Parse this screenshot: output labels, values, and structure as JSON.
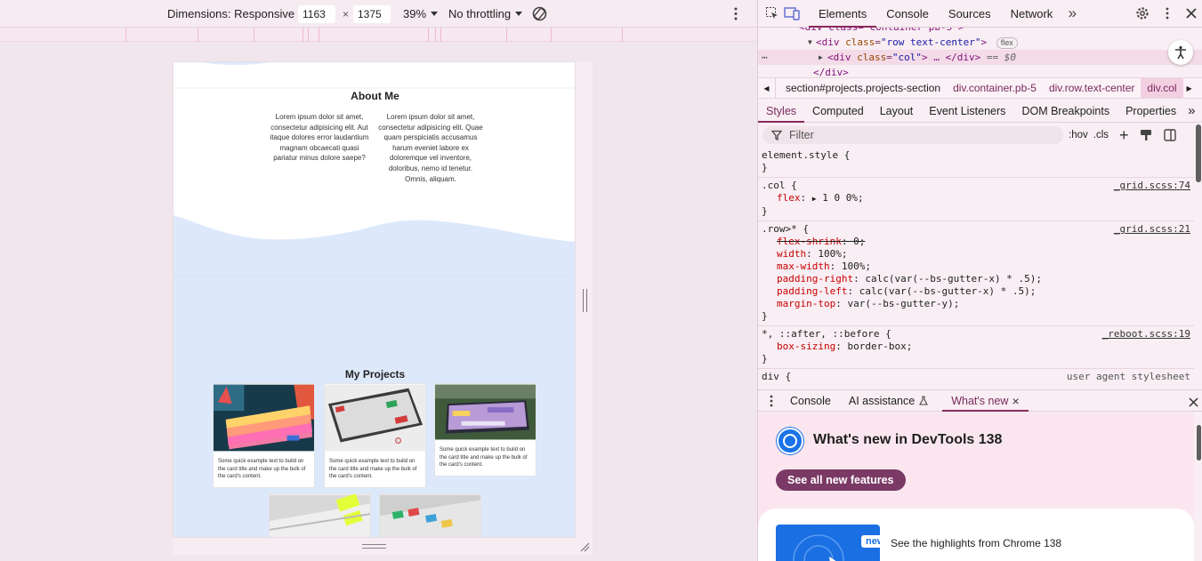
{
  "toolbar": {
    "dimensions_label": "Dimensions: Responsive",
    "width_value": "1163",
    "times": "×",
    "height_value": "1375",
    "zoom": "39%",
    "throttling": "No throttling"
  },
  "page": {
    "about_title": "About Me",
    "about_col1": "Lorem ipsum dolor sit amet, consectetur adipisicing elit. Aut itaque dolores error laudantium magnam obcaecati quasi pariatur minus dolore saepe?",
    "about_col2": "Lorem ipsum dolor sit amet, consectetur adipisicing elit. Quae quam perspiciatis accusamus harum eveniet labore ex doloremque vel inventore, doloribus, nemo id tenetur. Omnis, aliquam.",
    "projects_title": "My Projects",
    "card_text": "Some quick example text to build on the card title and make up the bulk of the card's content.",
    "colors": {
      "wave": "#dde9fb",
      "page_bg": "#ffffff"
    }
  },
  "devtools": {
    "tabs": [
      "Elements",
      "Console",
      "Sources",
      "Network"
    ],
    "active_tab": "Elements",
    "more_tabs": "»",
    "dom": {
      "line0_tag": "<div class=\"container pb-5\">",
      "line1_open": "<div",
      "line1_attr": "class",
      "line1_val": "\"row text-center\"",
      "line1_close": ">",
      "line1_badge": "flex",
      "line2_open": "<div",
      "line2_attr": "class",
      "line2_val": "\"col\"",
      "line2_mid": "> … </div>",
      "line2_eq": " == $0",
      "line3": "</div>"
    },
    "breadcrumbs": [
      "section#projects.projects-section",
      "div.container.pb-5",
      "div.row.text-center",
      "div.col"
    ],
    "sub_tabs": [
      "Styles",
      "Computed",
      "Layout",
      "Event Listeners",
      "DOM Breakpoints",
      "Properties"
    ],
    "active_sub_tab": "Styles",
    "filter_placeholder": "Filter",
    "filter_hov": ":hov",
    "filter_cls": ".cls",
    "styles": {
      "element_style": "element.style {",
      "close": "}",
      "col_selector": ".col {",
      "col_src": "_grid.scss:74",
      "col_prop": "flex",
      "col_val": "1 0 0%;",
      "row_selector": ".row>* {",
      "row_src": "_grid.scss:21",
      "row_props": [
        {
          "name": "flex-shrink",
          "value": "0;"
        },
        {
          "name": "width",
          "value": "100%;"
        },
        {
          "name": "max-width",
          "value": "100%;"
        },
        {
          "name": "padding-right",
          "value": "calc(var(--bs-gutter-x) * .5);"
        },
        {
          "name": "padding-left",
          "value": "calc(var(--bs-gutter-x) * .5);"
        },
        {
          "name": "margin-top",
          "value": "var(--bs-gutter-y);"
        }
      ],
      "reboot_selector": "*, ::after, ::before {",
      "reboot_src": "_reboot.scss:19",
      "reboot_prop": "box-sizing",
      "reboot_val": "border-box;",
      "next_selector": "div {",
      "next_src": "user agent stylesheet"
    },
    "drawer_tabs": [
      "Console",
      "AI assistance",
      "What's new"
    ],
    "active_drawer_tab": "What's new",
    "whats_new_title": "What's new in DevTools 138",
    "see_all": "See all new features",
    "new_badge": "new",
    "highlights": "See the highlights from Chrome 138"
  }
}
